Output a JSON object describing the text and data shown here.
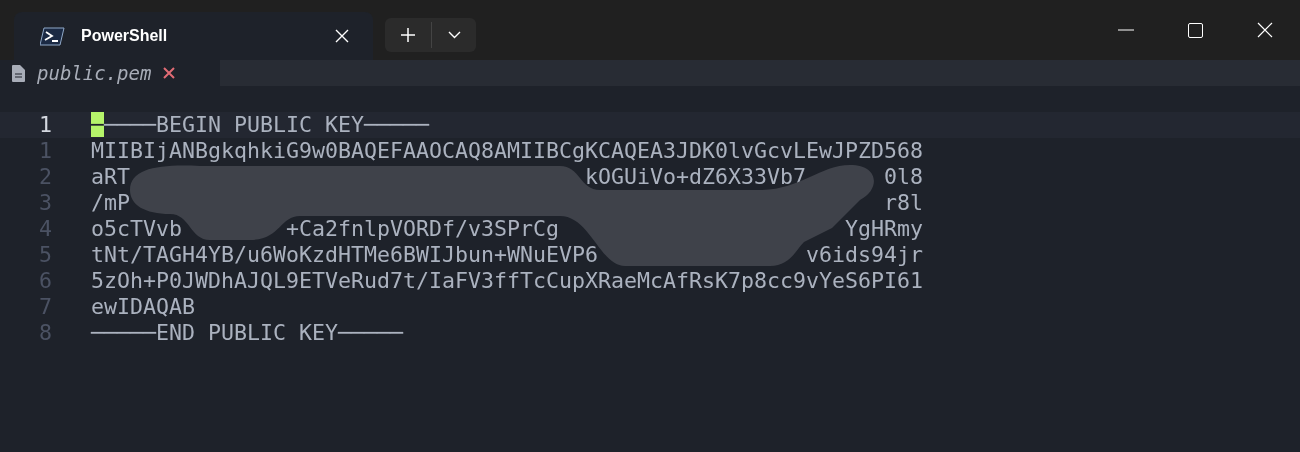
{
  "tabs": [
    {
      "title": "PowerShell",
      "selected": true
    }
  ],
  "buffer": {
    "name": "public.pem",
    "modified": true
  },
  "lines": [
    {
      "number": "1",
      "current": true,
      "cursor": true,
      "text": "─────BEGIN PUBLIC KEY─────"
    },
    {
      "number": "1",
      "current": false,
      "cursor": false,
      "text": "MIIBIjANBgkqhkiG9w0BAQEFAAOCAQ8AMIIBCgKCAQEA3JDK0lvGcvLEwJPZD568"
    },
    {
      "number": "2",
      "current": false,
      "cursor": false,
      "text": "aRT                                   kOGUiVo+dZ6X33Vb7      0l8"
    },
    {
      "number": "3",
      "current": false,
      "cursor": false,
      "text": "/mP                                                          r8l"
    },
    {
      "number": "4",
      "current": false,
      "cursor": false,
      "text": "o5cTVvb        +Ca2fnlpVORDf/v3SPrCg                      YgHRmy"
    },
    {
      "number": "5",
      "current": false,
      "cursor": false,
      "text": "tNt/TAGH4YB/u6WoKzdHTMe6BWIJbun+WNuEVP6                v6ids94jr"
    },
    {
      "number": "6",
      "current": false,
      "cursor": false,
      "text": "5zOh+P0JWDhAJQL9ETVeRud7t/IaFV3ffTcCupXRaeMcAfRsK7p8cc9vYeS6PI61"
    },
    {
      "number": "7",
      "current": false,
      "cursor": false,
      "text": "ewIDAQAB"
    },
    {
      "number": "8",
      "current": false,
      "cursor": false,
      "text": "─────END PUBLIC KEY─────"
    }
  ]
}
